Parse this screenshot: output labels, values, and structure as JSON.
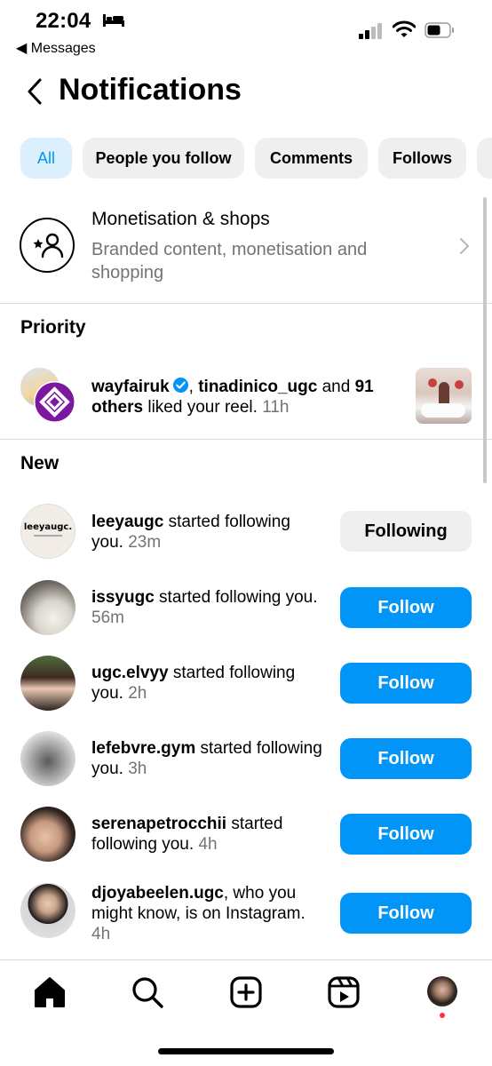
{
  "status": {
    "time": "22:04",
    "back_app": "◀ Messages"
  },
  "header": {
    "title": "Notifications"
  },
  "chips": [
    "All",
    "People you follow",
    "Comments",
    "Follows"
  ],
  "monetisation": {
    "title": "Monetisation & shops",
    "subtitle": "Branded content, monetisation and shopping"
  },
  "sections": {
    "priority": "Priority",
    "new": "New"
  },
  "priority": {
    "user1": "wayfairuk",
    "sep": ", ",
    "user2": "tinadinico_ugc",
    "and": " and ",
    "count": "91",
    "others": "others",
    "action": " liked your reel. ",
    "time": "11h"
  },
  "new_items": [
    {
      "user": "leeyaugc",
      "text": " started following you. ",
      "time": "23m",
      "button": "Following",
      "avatar_text": "leeyaugc."
    },
    {
      "user": "issyugc",
      "text": " started following you. ",
      "time": "56m",
      "button": "Follow"
    },
    {
      "user": "ugc.elvyy",
      "text": " started following you. ",
      "time": "2h",
      "button": "Follow"
    },
    {
      "user": "lefebvre.gym",
      "text": " started following you. ",
      "time": "3h",
      "button": "Follow"
    },
    {
      "user": "serenapetrocchii",
      "text": " started following you. ",
      "time": "4h",
      "button": "Follow"
    },
    {
      "user": "djoyabeelen.ugc",
      "text": ", who you might know, is on Instagram. ",
      "time": "4h",
      "button": "Follow"
    }
  ],
  "colors": {
    "accent": "#0095f6",
    "chip_bg": "#efefef",
    "active_chip_bg": "#dbeffd",
    "muted": "#737373"
  },
  "nav_icons": [
    "home-icon",
    "search-icon",
    "create-icon",
    "reels-icon",
    "profile-avatar"
  ]
}
